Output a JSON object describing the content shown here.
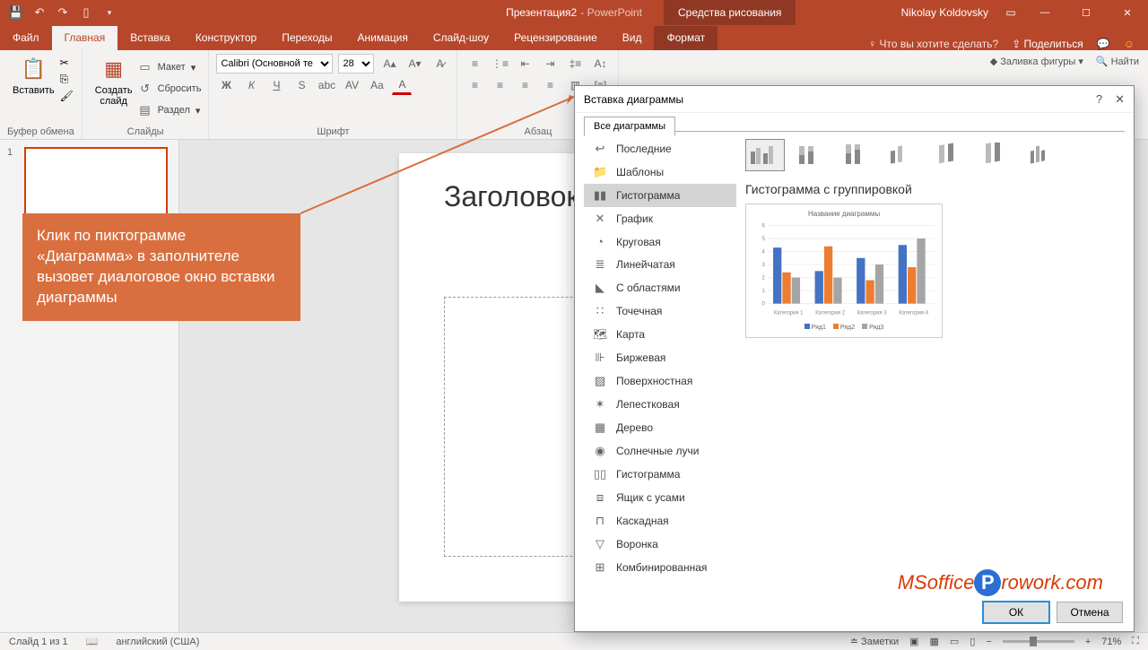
{
  "titlebar": {
    "doc_title": "Презентация2",
    "app_suffix": " -  PowerPoint",
    "contextual": "Средства рисования",
    "user": "Nikolay Koldovsky"
  },
  "tabs": {
    "file": "Файл",
    "home": "Главная",
    "insert": "Вставка",
    "design": "Конструктор",
    "transitions": "Переходы",
    "animations": "Анимация",
    "slideshow": "Слайд-шоу",
    "review": "Рецензирование",
    "view": "Вид",
    "format": "Формат",
    "tell_me": "Что вы хотите сделать?",
    "share": "Поделиться"
  },
  "ribbon": {
    "paste": "Вставить",
    "clipboard": "Буфер обмена",
    "new_slide": "Создать\nслайд",
    "layout": "Макет",
    "reset": "Сбросить",
    "section": "Раздел",
    "slides": "Слайды",
    "font_name": "Calibri (Основной те",
    "font_size": "28",
    "font": "Шрифт",
    "paragraph": "Абзац",
    "shape_fill": "Заливка фигуры",
    "find": "Найти"
  },
  "thumbs": {
    "n1": "1"
  },
  "slide": {
    "title": "Заголовок слайда"
  },
  "callout": {
    "text": "Клик по пиктограмме «Диаграмма» в заполнителе вызовет диалоговое окно вставки диаграммы"
  },
  "dialog": {
    "title": "Вставка диаграммы",
    "tab_all": "Все диаграммы",
    "cats": [
      "Последние",
      "Шаблоны",
      "Гистограмма",
      "График",
      "Круговая",
      "Линейчатая",
      "С областями",
      "Точечная",
      "Карта",
      "Биржевая",
      "Поверхностная",
      "Лепестковая",
      "Дерево",
      "Солнечные лучи",
      "Гистограмма",
      "Ящик с усами",
      "Каскадная",
      "Воронка",
      "Комбинированная"
    ],
    "preview_title": "Гистограмма с группировкой",
    "ok": "ОК",
    "cancel": "Отмена"
  },
  "status": {
    "slide": "Слайд 1 из 1",
    "lang": "английский (США)",
    "notes": "Заметки",
    "zoom": "71%"
  },
  "watermark": {
    "a": "MSoffice",
    "b": "rowork.com"
  },
  "chart_data": {
    "type": "bar",
    "title": "Название диаграммы",
    "categories": [
      "Категория 1",
      "Категория 2",
      "Категория 3",
      "Категория 4"
    ],
    "series": [
      {
        "name": "Ряд1",
        "color": "#4472c4",
        "values": [
          4.3,
          2.5,
          3.5,
          4.5
        ]
      },
      {
        "name": "Ряд2",
        "color": "#ed7d31",
        "values": [
          2.4,
          4.4,
          1.8,
          2.8
        ]
      },
      {
        "name": "Ряд3",
        "color": "#a5a5a5",
        "values": [
          2.0,
          2.0,
          3.0,
          5.0
        ]
      }
    ],
    "ylabel": "",
    "xlabel": "",
    "ylim": [
      0,
      6
    ],
    "yticks": [
      0,
      1,
      2,
      3,
      4,
      5,
      6
    ]
  }
}
